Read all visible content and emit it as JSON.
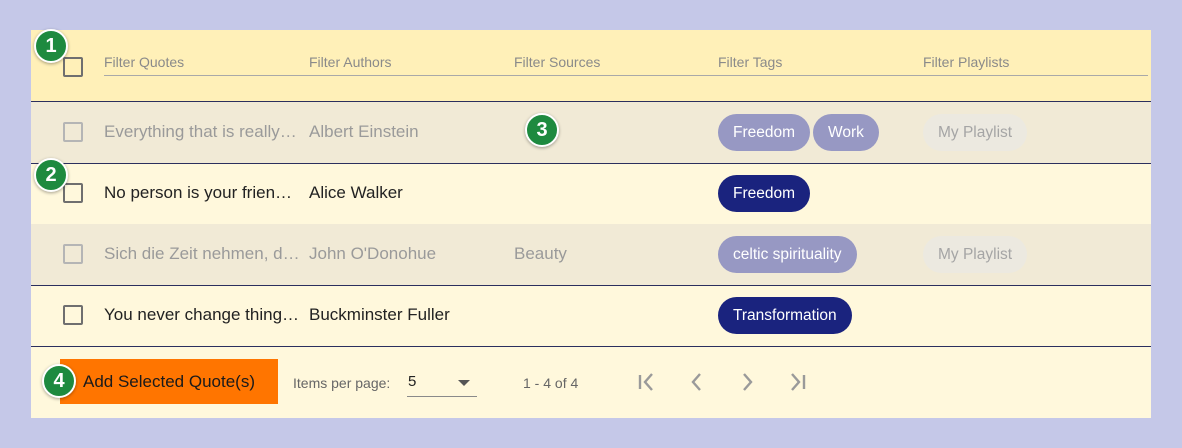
{
  "header": {
    "filter_quotes": "Filter Quotes",
    "filter_authors": "Filter Authors",
    "filter_sources": "Filter Sources",
    "filter_tags": "Filter Tags",
    "filter_playlists": "Filter Playlists"
  },
  "rows": [
    {
      "quote": "Everything that is really great and inspiring is created by the individual who can labor in freedom.",
      "author": "Albert Einstein",
      "source": "",
      "tags": [
        "Freedom",
        "Work"
      ],
      "playlist": "My Playlist",
      "dimmed": true
    },
    {
      "quote": "No person is your friend who demands your silence, or denies your right to grow.",
      "author": "Alice Walker",
      "source": "",
      "tags": [
        "Freedom"
      ],
      "playlist": "",
      "dimmed": false
    },
    {
      "quote": "Sich die Zeit nehmen, das eigene Leben zu betrachten.",
      "author": "John O'Donohue",
      "source": "Beauty",
      "tags": [
        "celtic spirituality"
      ],
      "playlist": "My Playlist",
      "dimmed": true
    },
    {
      "quote": "You never change things by fighting the existing reality.",
      "author": "Buckminster Fuller",
      "source": "",
      "tags": [
        "Transformation"
      ],
      "playlist": "",
      "dimmed": false
    }
  ],
  "footer": {
    "add_button": "Add Selected Quote(s)",
    "items_per_page_label": "Items per page:",
    "items_per_page_value": "5",
    "range": "1 - 4 of 4"
  },
  "pagination_icons": [
    "first-page-icon",
    "previous-page-icon",
    "next-page-icon",
    "last-page-icon"
  ],
  "badges": [
    "1",
    "2",
    "3",
    "4"
  ],
  "colors": {
    "background": "#c5c8e8",
    "header": "#fff0b8",
    "row": "#fff8dc",
    "row_dimmed": "#f1ead6",
    "chip": "#1a237e",
    "chip_dimmed": "#9798c3",
    "add_button": "#ff7500",
    "badge": "#1e8a3f"
  }
}
